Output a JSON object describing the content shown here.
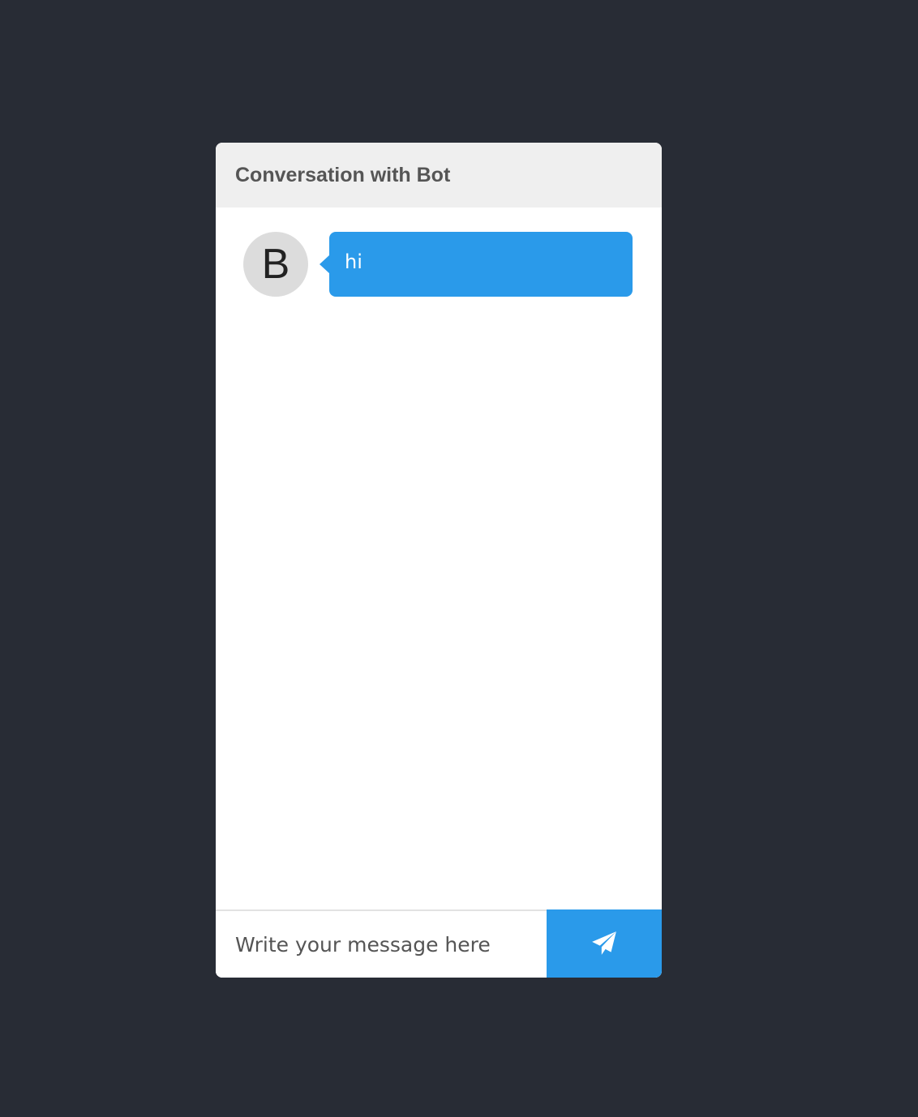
{
  "chat": {
    "title": "Conversation with Bot",
    "messages": [
      {
        "sender": "bot",
        "avatar_letter": "B",
        "text": "hi"
      }
    ]
  },
  "composer": {
    "placeholder": "Write your message here",
    "value": "",
    "send_icon": "paper-plane-icon"
  },
  "colors": {
    "background": "#282c35",
    "header": "#efefef",
    "accent": "#2a9aea",
    "avatar": "#dcdcdc"
  }
}
